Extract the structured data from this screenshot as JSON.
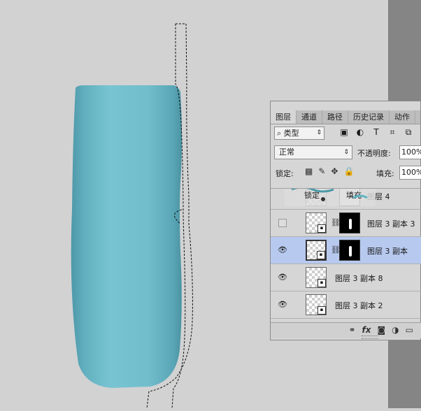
{
  "tabs": [
    "图层",
    "通道",
    "路径",
    "历史记录",
    "动作"
  ],
  "filter": {
    "label": "类型",
    "icons": [
      "image-filter-icon",
      "adjustment-filter-icon",
      "type-filter-icon",
      "shape-filter-icon",
      "smart-object-filter-icon"
    ]
  },
  "blend_mode": "正常",
  "opacity_label": "不透明度:",
  "opacity_value": "100%",
  "lock_label": "锁定:",
  "fill_label": "填充:",
  "fill_value": "100%",
  "drag_overlay_label": "锁定",
  "drag_overlay_fill": "填充",
  "layers": [
    {
      "name": "图层 4",
      "visible": true
    },
    {
      "name": "图层 3 副本 3",
      "visible": false
    },
    {
      "name": "图层 3 副本",
      "visible": true,
      "selected": true
    },
    {
      "name": "图层 3 副本 8",
      "visible": true
    },
    {
      "name": "图层 3 副本 2",
      "visible": true
    }
  ],
  "footer_icons": [
    "link-icon",
    "fx-icon",
    "mask-icon",
    "adjustment-icon",
    "folder-icon"
  ],
  "colors": {
    "bottle": "#72bccb",
    "canvas": "#d2d2d3",
    "selection": "#b7c9ee"
  }
}
